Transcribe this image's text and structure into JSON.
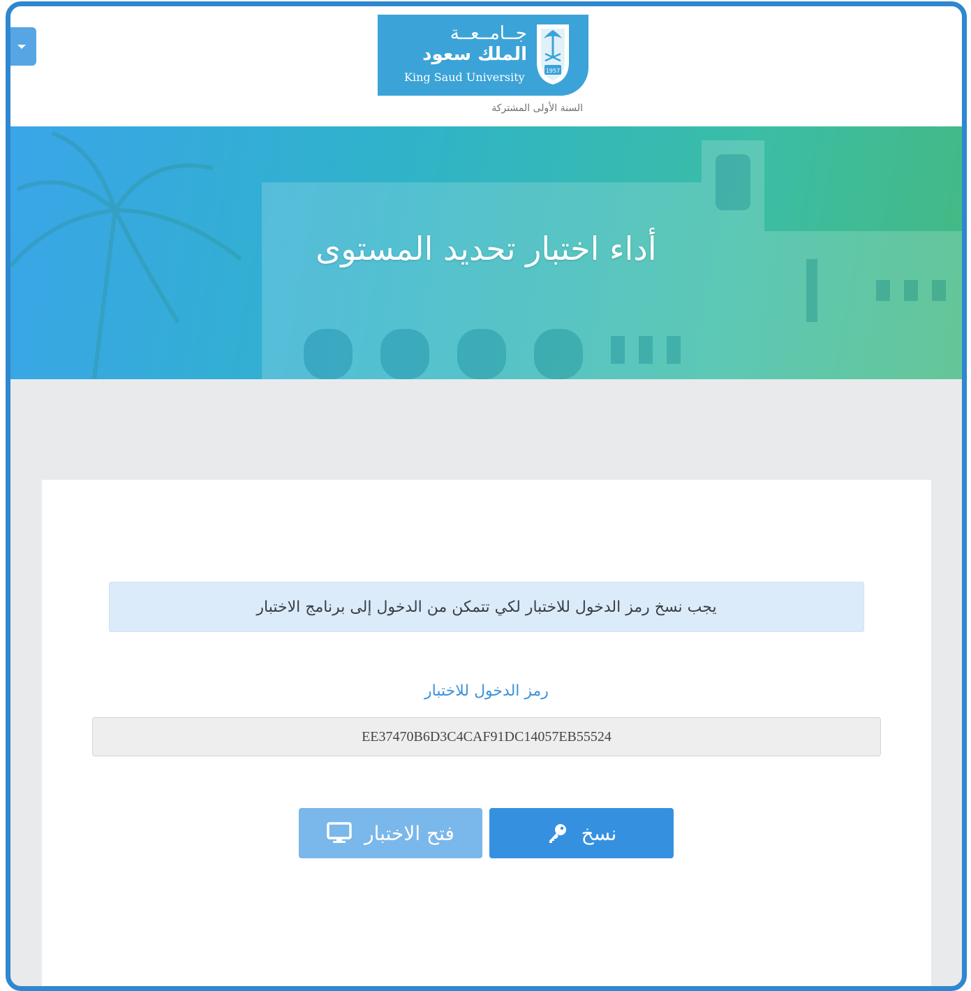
{
  "header": {
    "logo": {
      "arabic_line1": "جــامــعــة",
      "arabic_line2": "الملك سعود",
      "english": "King Saud University",
      "emblem_year": "1957",
      "subtitle": "السنة الأولى المشتركة"
    },
    "menu_toggle_icon": "caret-down-icon"
  },
  "banner": {
    "title": "أداء اختبار تحديد المستوى"
  },
  "main": {
    "notice": "يجب نسخ رمز الدخول للاختبار لكي تتمكن من الدخول إلى برنامج الاختبار",
    "code_label": "رمز الدخول للاختبار",
    "code_value": "EE37470B6D3C4CAF91DC14057EB55524",
    "buttons": {
      "open_label": "فتح الاختبار",
      "open_icon": "monitor-icon",
      "copy_label": "نسخ",
      "copy_icon": "key-icon"
    }
  },
  "colors": {
    "frame": "#2f87cf",
    "primary_button": "#3591e0",
    "disabled_button": "#7ab7ea",
    "logo_background": "#3ba3d7",
    "notice_background": "#dcebf9",
    "label_text": "#3d92d9"
  }
}
